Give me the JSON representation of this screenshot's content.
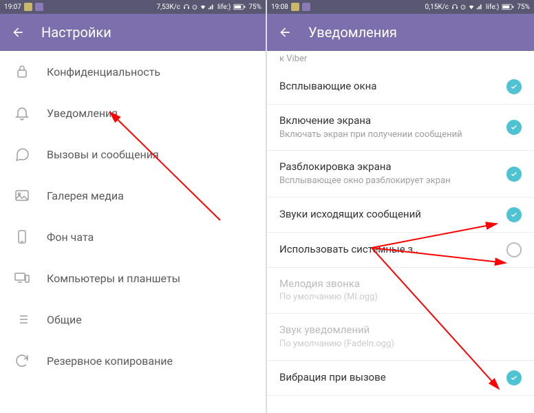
{
  "left": {
    "status": {
      "time": "19:07",
      "speed": "7,53K/c",
      "carrier": "life:)",
      "battery": "75%"
    },
    "header": {
      "title": "Настройки"
    },
    "menu": [
      {
        "label": "Конфиденциальность",
        "icon": "lock-icon"
      },
      {
        "label": "Уведомления",
        "icon": "bell-icon"
      },
      {
        "label": "Вызовы и сообщения",
        "icon": "message-icon"
      },
      {
        "label": "Галерея медиа",
        "icon": "gallery-icon"
      },
      {
        "label": "Фон чата",
        "icon": "phone-icon"
      },
      {
        "label": "Компьютеры и планшеты",
        "icon": "devices-icon"
      },
      {
        "label": "Общие",
        "icon": "list-icon"
      },
      {
        "label": "Резервное копирование",
        "icon": "sync-icon"
      }
    ]
  },
  "right": {
    "status": {
      "time": "19:08",
      "speed": "0,15K/c",
      "carrier": "life:)",
      "battery": "75%"
    },
    "header": {
      "title": "Уведомления"
    },
    "truncated": "к Viber",
    "settings": [
      {
        "title": "Всплывающие окна",
        "sub": "",
        "on": true
      },
      {
        "title": "Включение экрана",
        "sub": "Включать экран при получении сообщений",
        "on": true
      },
      {
        "title": "Разблокировка экрана",
        "sub": "Всплывающее окно разблокирует экран",
        "on": true
      },
      {
        "title": "Звуки исходящих сообщений",
        "sub": "",
        "on": true
      },
      {
        "title": "Использовать системные з..",
        "sub": "",
        "on": false
      },
      {
        "title": "Мелодия звонка",
        "sub": "По умолчанию (MI.ogg)",
        "on": null,
        "disabled": true
      },
      {
        "title": "Звук уведомлений",
        "sub": "По умолчанию (FadeIn.ogg)",
        "on": null,
        "disabled": true
      },
      {
        "title": "Вибрация при вызове",
        "sub": "",
        "on": true
      }
    ]
  }
}
